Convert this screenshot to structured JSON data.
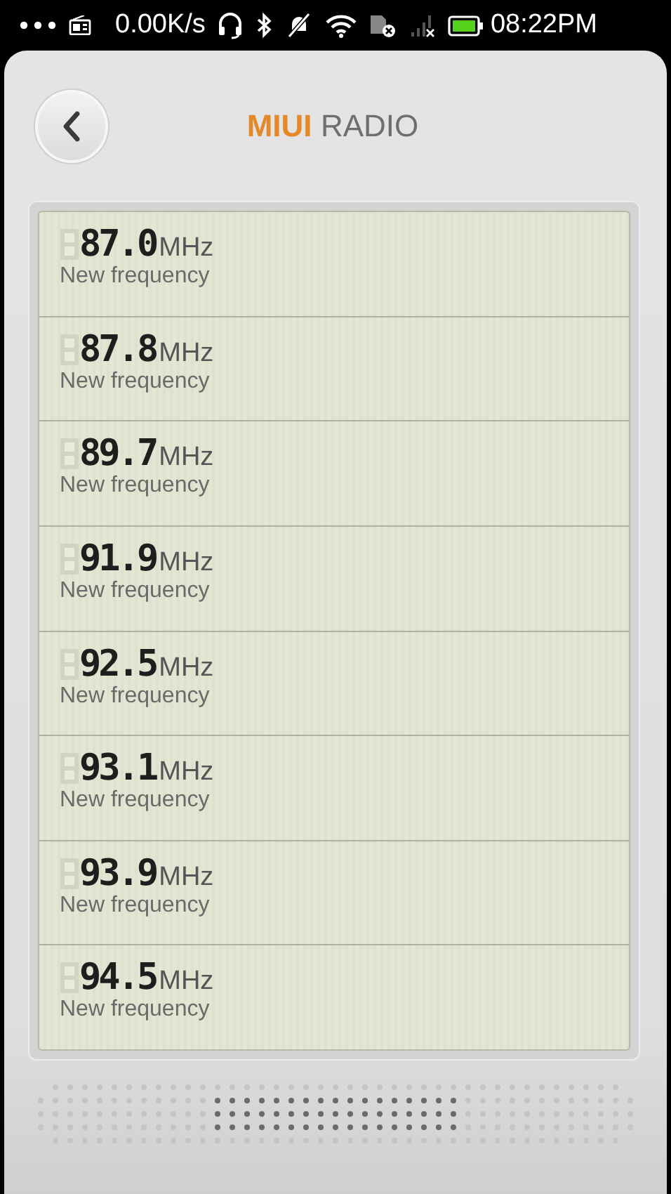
{
  "status_bar": {
    "speed": "0.00K/s",
    "time": "08:22PM"
  },
  "header": {
    "title_brand": "MIUI",
    "title_rest": "RADIO"
  },
  "stations": [
    {
      "frequency": "87.0",
      "unit": "MHz",
      "label": "New frequency"
    },
    {
      "frequency": "87.8",
      "unit": "MHz",
      "label": "New frequency"
    },
    {
      "frequency": "89.7",
      "unit": "MHz",
      "label": "New frequency"
    },
    {
      "frequency": "91.9",
      "unit": "MHz",
      "label": "New frequency"
    },
    {
      "frequency": "92.5",
      "unit": "MHz",
      "label": "New frequency"
    },
    {
      "frequency": "93.1",
      "unit": "MHz",
      "label": "New frequency"
    },
    {
      "frequency": "93.9",
      "unit": "MHz",
      "label": "New frequency"
    },
    {
      "frequency": "94.5",
      "unit": "MHz",
      "label": "New frequency"
    }
  ]
}
